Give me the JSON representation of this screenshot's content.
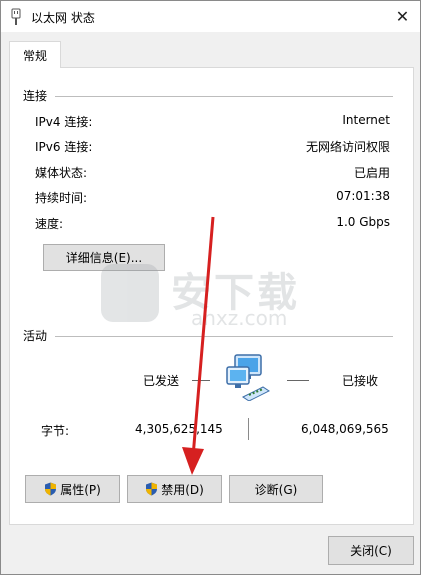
{
  "window": {
    "title": "以太网 状态",
    "close_glyph": "✕"
  },
  "tab": {
    "label": "常规"
  },
  "connection": {
    "group_label": "连接",
    "rows": [
      {
        "label": "IPv4 连接:",
        "value": "Internet"
      },
      {
        "label": "IPv6 连接:",
        "value": "无网络访问权限"
      },
      {
        "label": "媒体状态:",
        "value": "已启用"
      },
      {
        "label": "持续时间:",
        "value": "07:01:38"
      },
      {
        "label": "速度:",
        "value": "1.0 Gbps"
      }
    ],
    "details_button": "详细信息(E)..."
  },
  "activity": {
    "group_label": "活动",
    "sent_label": "已发送",
    "received_label": "已接收",
    "bytes_label": "字节:",
    "bytes_sent": "4,305,625,145",
    "bytes_received": "6,048,069,565",
    "network_icon": "network-computers-icon"
  },
  "buttons": {
    "properties": "属性(P)",
    "disable": "禁用(D)",
    "diagnose": "诊断(G)",
    "close": "关闭(C)"
  },
  "watermark": {
    "text": "安下载",
    "sub": "anxz.com"
  },
  "colors": {
    "arrow": "#d62020",
    "shield_blue": "#2a5db0",
    "shield_gold": "#f0b400"
  }
}
